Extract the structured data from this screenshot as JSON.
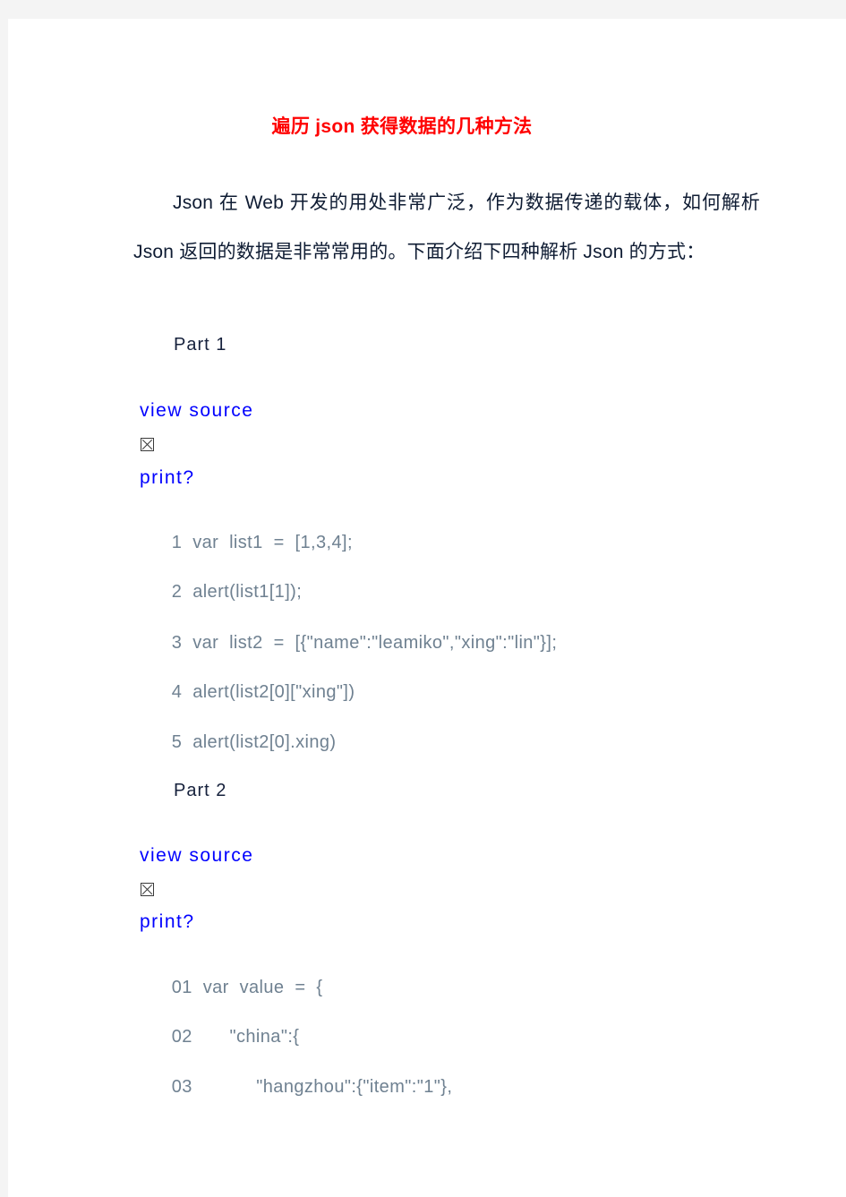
{
  "document": {
    "title": "遍历 json 获得数据的几种方法",
    "title_color": "#ff0000",
    "page_background": "#ffffff",
    "canvas_background": "#f4f4f4",
    "paragraph": "Json 在 Web 开发的用处非常广泛，作为数据传递的载体，如何解析 Json 返回的数据是非常常用的。下面介绍下四种解析 Json 的方式："
  },
  "sections": [
    {
      "heading": "Part  1",
      "view_source_label": "view  source",
      "print_label": "print?",
      "glyph": "missing-glyph-box",
      "link_color": "#0000ff",
      "code": [
        {
          "number": "1",
          "text": "var  list1  =  [1,3,4];"
        },
        {
          "number": "2",
          "text": "alert(list1[1]);"
        },
        {
          "number": "3",
          "text": "var  list2  =  [{\"name\":\"leamiko\",\"xing\":\"lin\"}];"
        },
        {
          "number": "4",
          "text": "alert(list2[0][\"xing\"])"
        },
        {
          "number": "5",
          "text": "alert(list2[0].xing)"
        }
      ]
    },
    {
      "heading": "Part  2",
      "view_source_label": "view  source",
      "print_label": "print?",
      "glyph": "missing-glyph-box",
      "link_color": "#0000ff",
      "code": [
        {
          "number": "01",
          "text": "var  value  =  {"
        },
        {
          "number": "02",
          "text": "     \"china\":{"
        },
        {
          "number": "03",
          "text": "          \"hangzhou\":{\"item\":\"1\"},"
        }
      ]
    }
  ]
}
